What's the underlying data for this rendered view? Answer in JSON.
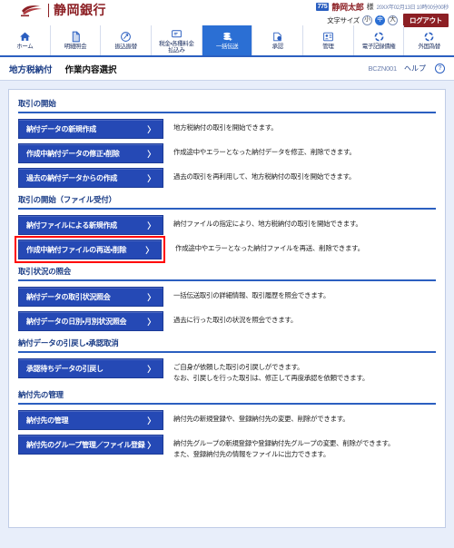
{
  "header": {
    "bank_name": "静岡銀行",
    "logo_badge": "775",
    "user_name": "静岡太郎",
    "user_honorific": "様",
    "timestamp": "20XX年02月13日 10時00分00秒",
    "font_size_label": "文字サイズ",
    "font_sizes": [
      {
        "label": "小",
        "active": false
      },
      {
        "label": "中",
        "active": true
      },
      {
        "label": "大",
        "active": false
      }
    ],
    "logout_label": "ログアウト",
    "accent_color": "#2b5fc0",
    "brand_color": "#8c1f24"
  },
  "nav": {
    "items": [
      {
        "label": "ホーム",
        "icon": "home-icon",
        "active": false
      },
      {
        "label": "明細照会",
        "icon": "document-icon",
        "active": false
      },
      {
        "label": "振込振替",
        "icon": "transfer-icon",
        "active": false
      },
      {
        "label": "税金・各種料金\n払込み",
        "icon": "payment-icon",
        "active": false
      },
      {
        "label": "一括伝送",
        "icon": "batch-icon",
        "active": true
      },
      {
        "label": "承認",
        "icon": "approve-icon",
        "active": false
      },
      {
        "label": "管理",
        "icon": "manage-icon",
        "active": false
      },
      {
        "label": "電子記録債権",
        "icon": "ebond-icon",
        "active": false
      },
      {
        "label": "外国為替",
        "icon": "forex-icon",
        "active": false
      }
    ]
  },
  "titlebar": {
    "category": "地方税納付",
    "page_title": "作業内容選択",
    "screen_code": "BCZN001",
    "help_label": "ヘルプ",
    "help_icon": "question-icon"
  },
  "sections": [
    {
      "title": "取引の開始",
      "rows": [
        {
          "button": "納付データの新規作成",
          "desc": "地方税納付の取引を開始できます。",
          "highlighted": false
        },
        {
          "button": "作成中納付データの修正・削除",
          "desc": "作成途中やエラーとなった納付データを修正、削除できます。",
          "highlighted": false
        },
        {
          "button": "過去の納付データからの作成",
          "desc": "過去の取引を再利用して、地方税納付の取引を開始できます。",
          "highlighted": false
        }
      ]
    },
    {
      "title": "取引の開始（ファイル受付）",
      "rows": [
        {
          "button": "納付ファイルによる新規作成",
          "desc": "納付ファイルの指定により、地方税納付の取引を開始できます。",
          "highlighted": false
        },
        {
          "button": "作成中納付ファイルの再送・削除",
          "desc": "作成途中やエラーとなった納付ファイルを再送、削除できます。",
          "highlighted": true
        }
      ]
    },
    {
      "title": "取引状況の照会",
      "rows": [
        {
          "button": "納付データの取引状況照会",
          "desc": "一括伝送取引の詳細情報、取引履歴を照会できます。",
          "highlighted": false
        },
        {
          "button": "納付データの日別・月別状況照会",
          "desc": "過去に行った取引の状況を照会できます。",
          "highlighted": false
        }
      ]
    },
    {
      "title": "納付データの引戻し・承認取消",
      "rows": [
        {
          "button": "承認待ちデータの引戻し",
          "desc": "ご自身が依頼した取引の引戻しができます。\nなお、引戻しを行った取引は、修正して再度承認を依頼できます。",
          "highlighted": false
        }
      ]
    },
    {
      "title": "納付先の管理",
      "rows": [
        {
          "button": "納付先の管理",
          "desc": "納付先の新規登録や、登録納付先の変更、削除ができます。",
          "highlighted": false
        },
        {
          "button": "納付先のグループ管理／ファイル登録",
          "desc": "納付先グループの新規登録や登録納付先グループの変更、削除ができます。\nまた、登録納付先の情報をファイルに出力できます。",
          "highlighted": false
        }
      ]
    }
  ],
  "chevron": "〉"
}
